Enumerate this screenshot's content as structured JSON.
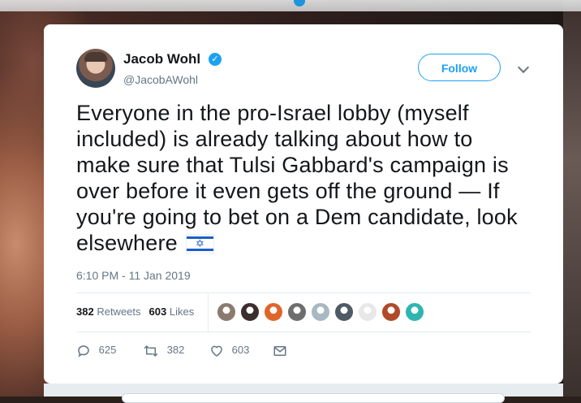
{
  "tweet": {
    "author_name": "Jacob Wohl",
    "author_handle": "@JacobAWohl",
    "follow_label": "Follow",
    "verified_glyph": "✓",
    "text": "Everyone in the pro-Israel lobby (myself included) is already talking about how to make sure that Tulsi Gabbard's campaign is over before it even gets off the ground — If you're going to bet on a Dem candidate, look elsewhere",
    "flag_icon": "israel-flag-emoji",
    "timestamp": "6:10 PM - 11 Jan 2019"
  },
  "stats": {
    "retweets_count": "382",
    "retweets_label": "Retweets",
    "likes_count": "603",
    "likes_label": "Likes"
  },
  "likers": [
    {
      "color": "#8b7b6e"
    },
    {
      "color": "#3a2f2d"
    },
    {
      "color": "#e0652a"
    },
    {
      "color": "#6e6e6e"
    },
    {
      "color": "#aab8c2"
    },
    {
      "color": "#4e5a66"
    },
    {
      "color": "#e8e8e8"
    },
    {
      "color": "#b04a2a"
    },
    {
      "color": "#2fb5b0"
    }
  ],
  "actions": {
    "reply_count": "625",
    "retweet_count": "382",
    "like_count": "603"
  },
  "colors": {
    "accent": "#1da1f2",
    "text": "#14171a",
    "muted": "#657786"
  }
}
